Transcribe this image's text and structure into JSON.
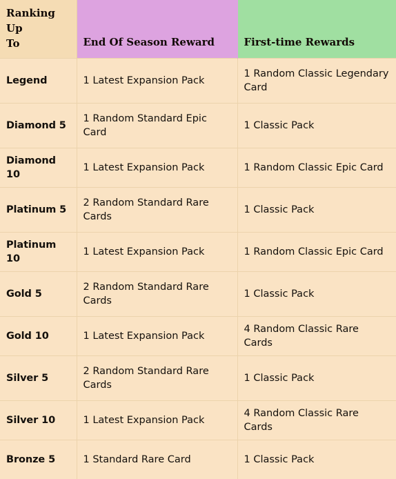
{
  "table": {
    "columns": [
      {
        "key": "rank",
        "label": "Ranking Up To",
        "bg": "#f5dcb4"
      },
      {
        "key": "season",
        "label": "End Of Season Reward",
        "bg": "#dda3e0"
      },
      {
        "key": "first",
        "label": "First-time Rewards",
        "bg": "#a0dfa1"
      }
    ],
    "header": {
      "rank_line1": "Ranking Up",
      "rank_line2": "To",
      "season": "End Of Season Reward",
      "first": "First-time Rewards"
    },
    "rows": [
      {
        "rank": "Legend",
        "season": "1 Latest Expansion Pack",
        "first": "1 Random Classic Legendary Card"
      },
      {
        "rank": "Diamond 5",
        "season": "1 Random Standard Epic Card",
        "first": "1 Classic Pack"
      },
      {
        "rank": "Diamond 10",
        "season": "1 Latest Expansion Pack",
        "first": "1 Random Classic Epic Card"
      },
      {
        "rank": "Platinum 5",
        "season": "2 Random Standard Rare Cards",
        "first": "1 Classic Pack"
      },
      {
        "rank": "Platinum 10",
        "season": "1 Latest Expansion Pack",
        "first": "1 Random Classic Epic Card"
      },
      {
        "rank": "Gold 5",
        "season": "2 Random Standard Rare Cards",
        "first": "1 Classic Pack"
      },
      {
        "rank": "Gold 10",
        "season": "1 Latest Expansion Pack",
        "first": "4 Random Classic Rare Cards"
      },
      {
        "rank": "Silver 5",
        "season": "2 Random Standard Rare Cards",
        "first": "1 Classic Pack"
      },
      {
        "rank": "Silver 10",
        "season": "1 Latest Expansion Pack",
        "first": "4 Random Classic Rare Cards"
      },
      {
        "rank": "Bronze 5",
        "season": "1 Standard Rare Card",
        "first": "1 Classic Pack"
      }
    ]
  },
  "colors": {
    "header_rank_bg": "#f5dcb4",
    "header_season_bg": "#dda3e0",
    "header_first_bg": "#a0dfa1",
    "body_bg": "#fae3c4",
    "grid_line": "#ecd3ac",
    "text": "#14100c"
  }
}
